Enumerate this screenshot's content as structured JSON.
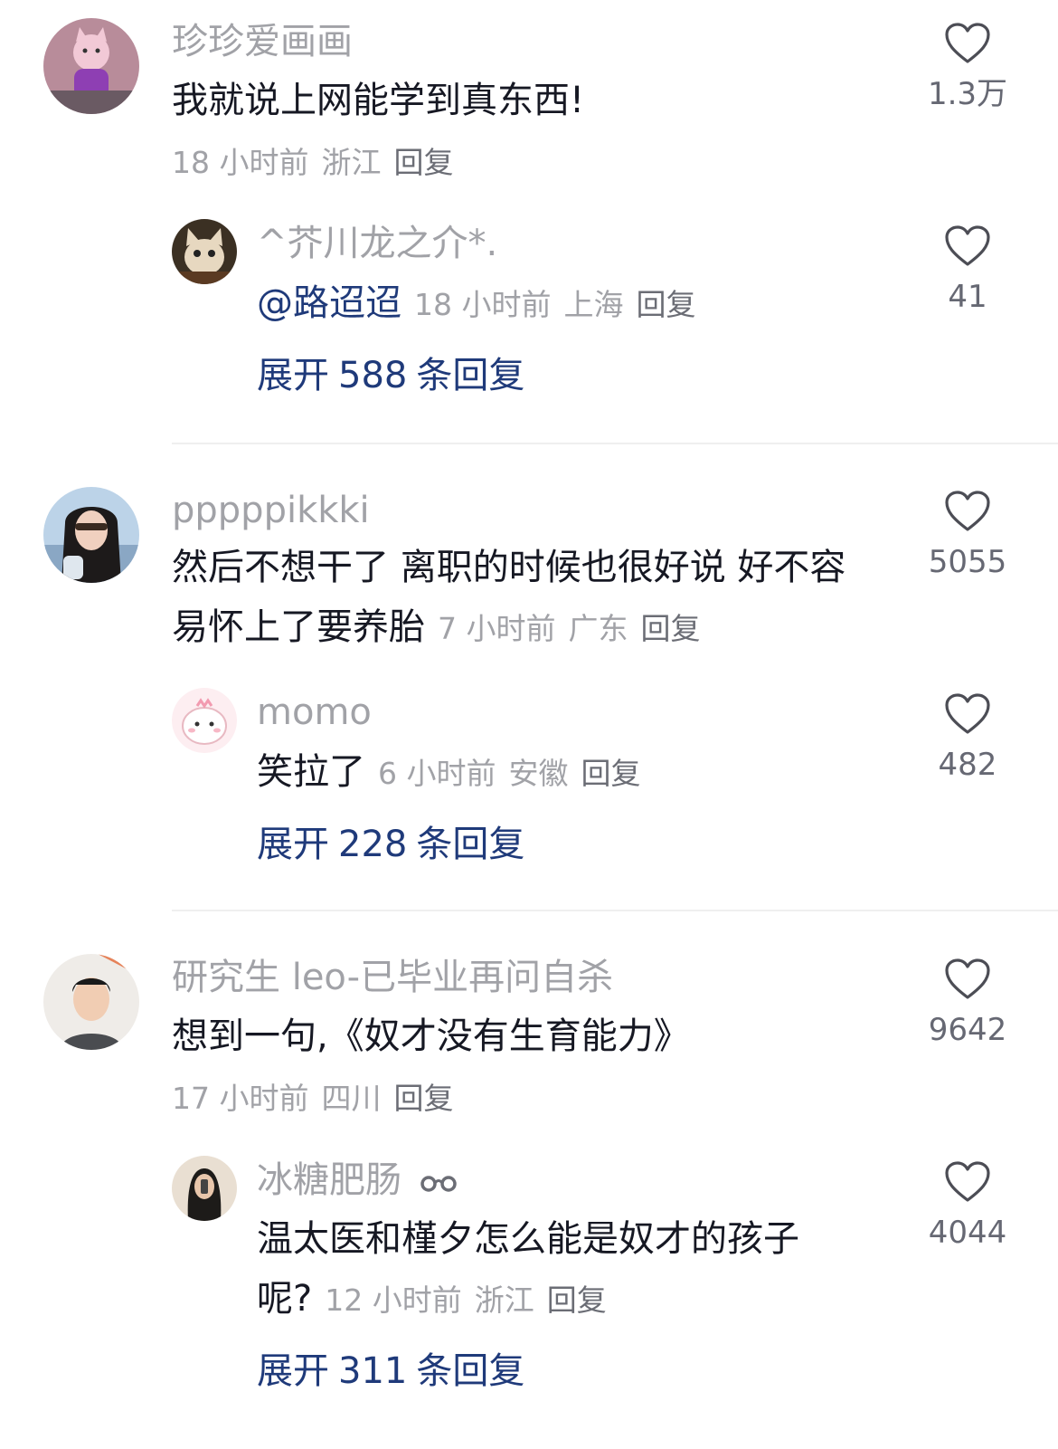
{
  "threads": [
    {
      "user": "珍珍爱画画",
      "text": "我就说上网能学到真东西!",
      "time": "18 小时前",
      "region": "浙江",
      "reply_label": "回复",
      "likes": "1.3万",
      "reply": {
        "user": "^芥川龙之介*.",
        "mention": "@路迢迢",
        "time": "18 小时前",
        "region": "上海",
        "reply_label": "回复",
        "likes": "41"
      },
      "expand": {
        "prefix": "展开",
        "count": "588",
        "suffix": "条回复"
      }
    },
    {
      "user": "pppppikkki",
      "text_line1": "然后不想干了 离职的时候也很好说 好不容",
      "text_line2": "易怀上了要养胎",
      "time": "7 小时前",
      "region": "广东",
      "reply_label": "回复",
      "likes": "5055",
      "reply": {
        "user": "momo",
        "text": "笑拉了",
        "time": "6 小时前",
        "region": "安徽",
        "reply_label": "回复",
        "likes": "482"
      },
      "expand": {
        "prefix": "展开",
        "count": "228",
        "suffix": "条回复"
      }
    },
    {
      "user": "研究生 leo-已毕业再问自杀",
      "text": "想到一句,《奴才没有生育能力》",
      "time": "17 小时前",
      "region": "四川",
      "reply_label": "回复",
      "likes": "9642",
      "reply": {
        "user": "冰糖肥肠",
        "text_line1": "温太医和槿夕怎么能是奴才的孩子",
        "text_line2": "呢?",
        "time": "12 小时前",
        "region": "浙江",
        "reply_label": "回复",
        "likes": "4044"
      },
      "expand": {
        "prefix": "展开",
        "count": "311",
        "suffix": "条回复"
      }
    }
  ],
  "colors": {
    "text": "#161823",
    "muted": "#a1a2a7",
    "link": "#1f3a7a"
  },
  "icons": {
    "like": "heart-outline-icon",
    "badge": "glasses-badge-icon"
  }
}
